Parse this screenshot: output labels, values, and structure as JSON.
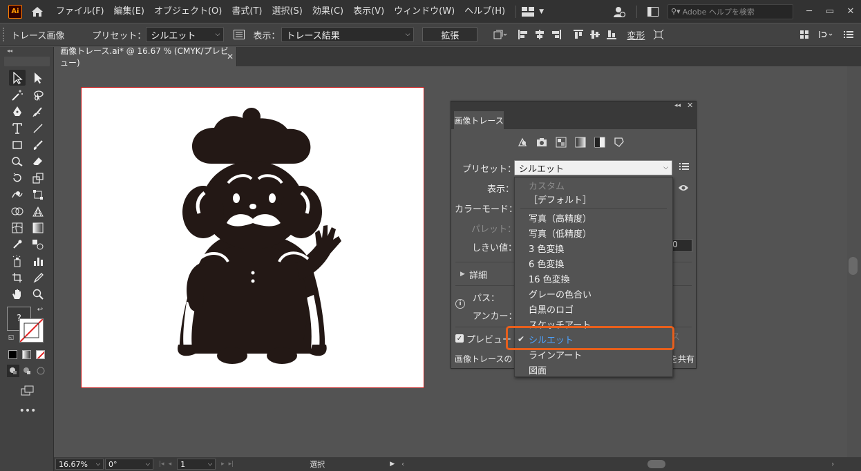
{
  "app": {
    "logo_text": "Ai",
    "menus": [
      "ファイル(F)",
      "編集(E)",
      "オブジェクト(O)",
      "書式(T)",
      "選択(S)",
      "効果(C)",
      "表示(V)",
      "ウィンドウ(W)",
      "ヘルプ(H)"
    ],
    "search_placeholder": "Adobe ヘルプを検索"
  },
  "control_bar": {
    "panel_name": "トレース画像",
    "preset_label": "プリセット：",
    "preset_value": "シルエット",
    "view_label": "表示：",
    "view_value": "トレース結果",
    "expand_button": "拡張",
    "transform_label": "変形"
  },
  "document": {
    "tab_title": "画像トレース.ai* @ 16.67 % (CMYK/プレビュー)"
  },
  "image_trace_panel": {
    "tab": "画像トレース",
    "preset_label": "プリセット：",
    "preset_value": "シルエット",
    "view_label": "表示：",
    "color_mode_label": "カラーモード：",
    "palette_label": "パレット：",
    "threshold_label": "しきい値：",
    "threshold_value": "0",
    "advanced_label": "詳細",
    "paths_label": "パス：",
    "anchors_label": "アンカー：",
    "preview_label": "プレビュー",
    "trace_button": "ス",
    "footer_text": "画像トレースの",
    "footer_share": "を共有"
  },
  "preset_dropdown": {
    "items": [
      {
        "label": "カスタム",
        "state": "disabled"
      },
      {
        "label": "［デフォルト］",
        "state": "normal"
      },
      {
        "label": "写真（高精度）",
        "state": "normal"
      },
      {
        "label": "写真（低精度）",
        "state": "normal"
      },
      {
        "label": "3 色変換",
        "state": "normal"
      },
      {
        "label": "6 色変換",
        "state": "normal"
      },
      {
        "label": "16 色変換",
        "state": "normal"
      },
      {
        "label": "グレーの色合い",
        "state": "normal"
      },
      {
        "label": "白黒のロゴ",
        "state": "normal"
      },
      {
        "label": "スケッチアート",
        "state": "normal"
      },
      {
        "label": "シルエット",
        "state": "selected"
      },
      {
        "label": "ラインアート",
        "state": "normal"
      },
      {
        "label": "図面",
        "state": "normal"
      }
    ]
  },
  "status_bar": {
    "zoom": "16.67%",
    "rotation": "0°",
    "artboard": "1",
    "mode": "選択"
  },
  "toolbox": {
    "fill_stroke_hint": "?"
  },
  "colors": {
    "accent_highlight": "#e85f1c",
    "selected_item": "#4da3ff",
    "artboard_border": "#c21717"
  }
}
